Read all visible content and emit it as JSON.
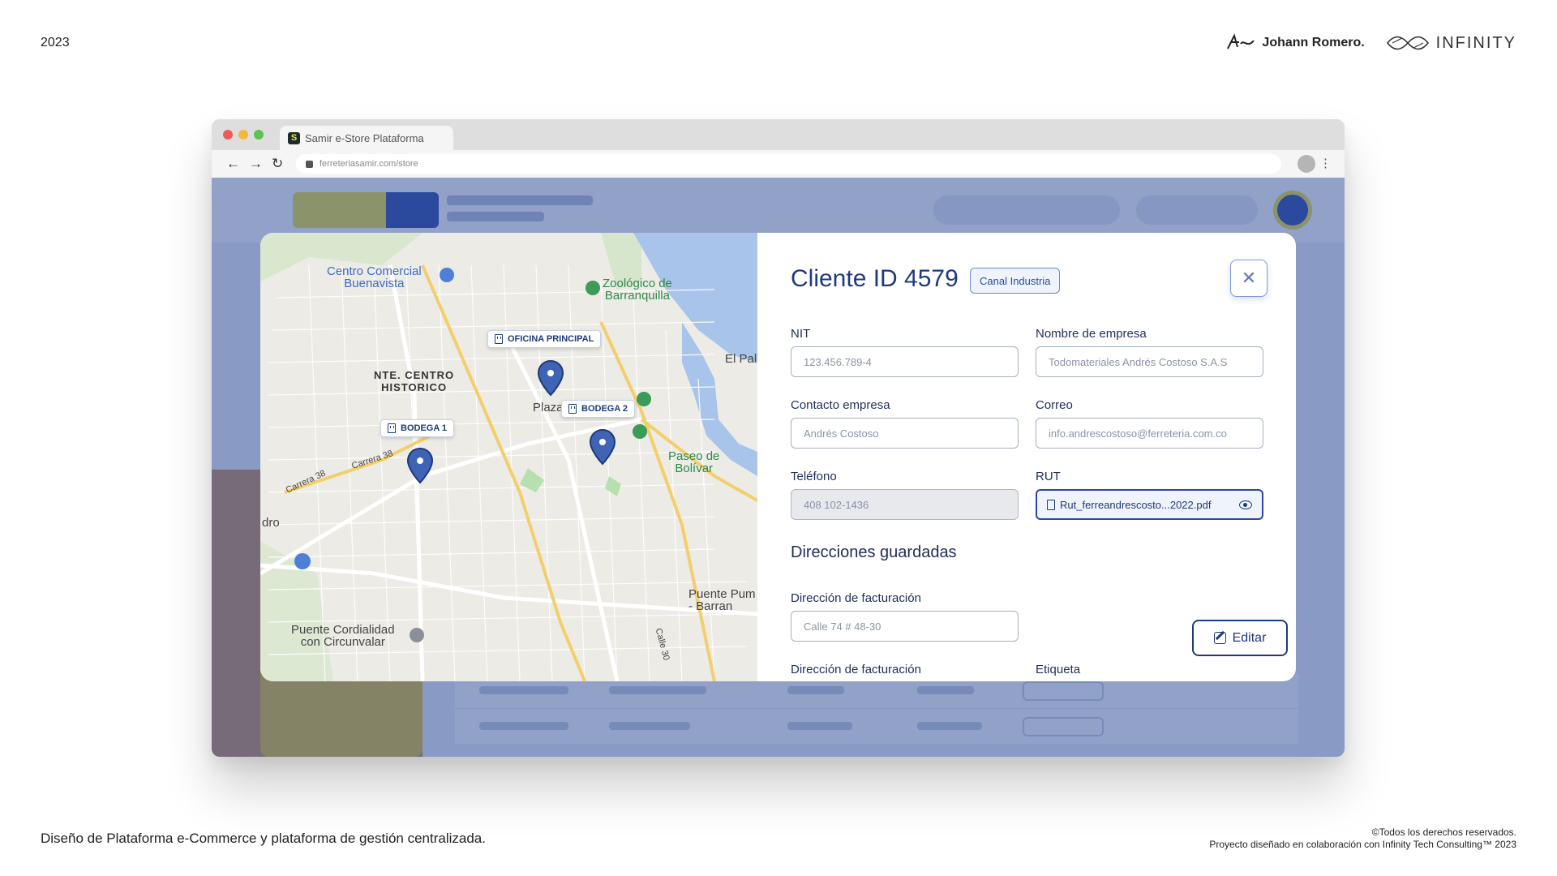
{
  "frame": {
    "year": "2023",
    "author": "Johann Romero.",
    "partner": "INFINITY",
    "description": "Diseño de Plataforma e-Commerce y plataforma de gestión centralizada.",
    "rights": "©Todos los derechos reservados.",
    "credit": "Proyecto diseñado en colaboración con Infinity Tech Consulting™ 2023"
  },
  "browser": {
    "tab_title": "Samir e-Store Plataforma",
    "url": "ferreteriasamir.com/store",
    "icons": [
      "back-arrow-icon",
      "forward-arrow-icon",
      "reload-icon",
      "lock-icon",
      "profile-icon",
      "kebab-menu-icon"
    ]
  },
  "map": {
    "places": {
      "centro_comercial": "Centro Comercial\nBuenavista",
      "zoologico": "Zoológico de\nBarranquilla",
      "centro_historico": "NTE. CENTRO\nHISTORICO",
      "plaza": "Plaza",
      "el_pal": "El Pal",
      "paseo_bolivar": "Paseo de\nBolívar",
      "dro": "dro",
      "puente_cordialidad": "Puente Cordialidad\ncon Circunvalar",
      "puente_pum": "Puente Pum\n- Barran",
      "carrera_38a": "Carrera 38",
      "carrera_38b": "Carrera 38",
      "calle_30": "Calle 30"
    },
    "markers": {
      "oficina": "OFICINA PRINCIPAL",
      "bodega1": "BODEGA 1",
      "bodega2": "BODEGA 2"
    }
  },
  "client": {
    "title": "Cliente ID 4579",
    "channel_badge": "Canal Industria",
    "fields": {
      "nit_label": "NIT",
      "nit_value": "123.456.789-4",
      "empresa_label": "Nombre de empresa",
      "empresa_value": "Todomateriales Andrés Costoso S.A.S",
      "contacto_label": "Contacto empresa",
      "contacto_value": "Andrés Costoso",
      "correo_label": "Correo",
      "correo_value": "info.andrescostoso@ferreteria.com.co",
      "telefono_label": "Teléfono",
      "telefono_value": "408 102-1436",
      "rut_label": "RUT",
      "rut_value": "Rut_ferreandrescosto...2022.pdf"
    },
    "addresses": {
      "section_title": "Direcciones guardadas",
      "billing_label": "Dirección de facturación",
      "billing_value": "Calle 74 # 48-30",
      "edit_label": "Editar",
      "billing_label_2": "Dirección de facturación",
      "etiqueta_label": "Etiqueta"
    }
  },
  "colors": {
    "primary": "#1f3a7a",
    "accent": "#2a47a6",
    "brand_yellow": "#f2e23e",
    "overlay": "#2d4b96"
  }
}
